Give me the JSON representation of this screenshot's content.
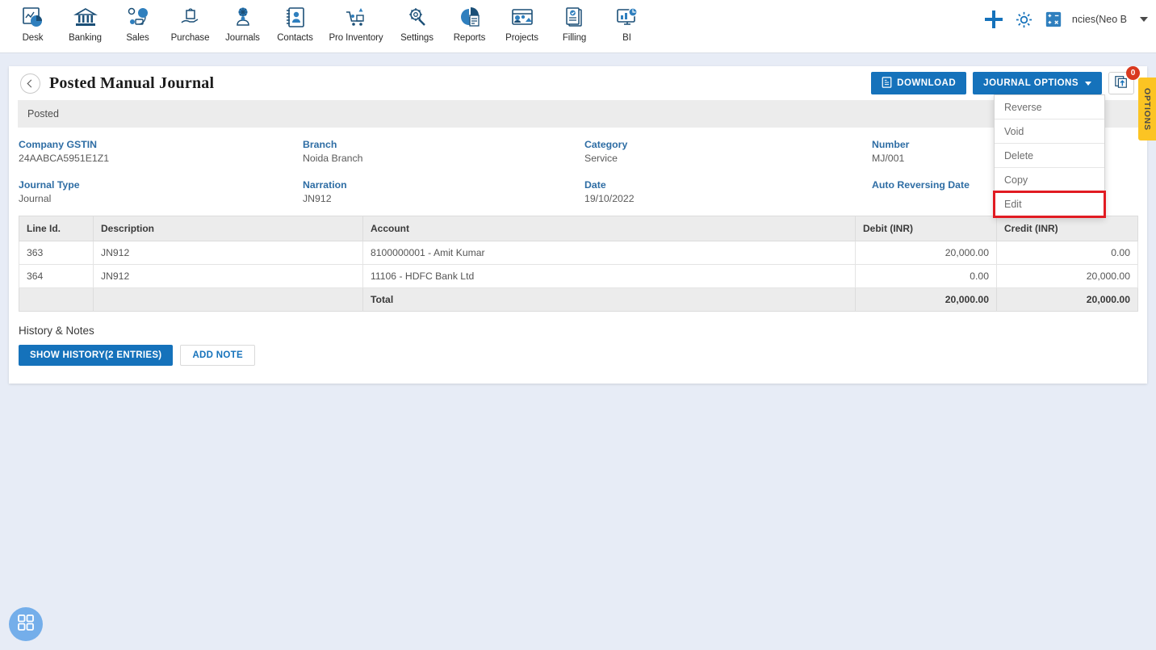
{
  "nav": {
    "items": [
      {
        "label": "Desk",
        "icon": "desk-icon"
      },
      {
        "label": "Banking",
        "icon": "bank-icon"
      },
      {
        "label": "Sales",
        "icon": "sales-icon"
      },
      {
        "label": "Purchase",
        "icon": "purchase-icon"
      },
      {
        "label": "Journals",
        "icon": "journals-icon"
      },
      {
        "label": "Contacts",
        "icon": "contacts-icon"
      },
      {
        "label": "Pro Inventory",
        "icon": "inventory-icon"
      },
      {
        "label": "Settings",
        "icon": "settings-icon"
      },
      {
        "label": "Reports",
        "icon": "reports-icon"
      },
      {
        "label": "Projects",
        "icon": "projects-icon"
      },
      {
        "label": "Filling",
        "icon": "filling-icon"
      },
      {
        "label": "BI",
        "icon": "bi-icon"
      }
    ],
    "right": {
      "add_icon": "plus-icon",
      "settings_icon": "gear-icon",
      "calculator_icon": "calculator-icon",
      "company": "ncies(Neo B",
      "chevron_icon": "chevron-down-icon"
    }
  },
  "header": {
    "back_icon": "back-chevron-icon",
    "title": "Posted Manual Journal",
    "download_label": "DOWNLOAD",
    "download_icon": "pdf-document-icon",
    "journal_options_label": "JOURNAL OPTIONS",
    "attach_icon": "upload-attachment-icon",
    "attach_badge": "0",
    "options_tab_label": "OPTIONS"
  },
  "dropdown": {
    "items": [
      {
        "label": "Reverse",
        "highlighted": false
      },
      {
        "label": "Void",
        "highlighted": false
      },
      {
        "label": "Delete",
        "highlighted": false
      },
      {
        "label": "Copy",
        "highlighted": false
      },
      {
        "label": "Edit",
        "highlighted": true
      }
    ]
  },
  "status": {
    "label": "Posted"
  },
  "details": [
    {
      "label": "Company GSTIN",
      "value": "24AABCA5951E1Z1"
    },
    {
      "label": "Branch",
      "value": "Noida Branch"
    },
    {
      "label": "Category",
      "value": "Service"
    },
    {
      "label": "Number",
      "value": "MJ/001"
    },
    {
      "label": "Journal Type",
      "value": "Journal"
    },
    {
      "label": "Narration",
      "value": "JN912"
    },
    {
      "label": "Date",
      "value": "19/10/2022"
    },
    {
      "label": "Auto Reversing Date",
      "value": ""
    }
  ],
  "table": {
    "columns": [
      "Line Id.",
      "Description",
      "Account",
      "Debit (INR)",
      "Credit (INR)"
    ],
    "rows": [
      {
        "line_id": "363",
        "description": "JN912",
        "account": "8100000001 - Amit Kumar",
        "debit": "20,000.00",
        "credit": "0.00"
      },
      {
        "line_id": "364",
        "description": "JN912",
        "account": "11106 - HDFC Bank Ltd",
        "debit": "0.00",
        "credit": "20,000.00"
      }
    ],
    "total": {
      "line_id": "",
      "description": "",
      "account": "Total",
      "debit": "20,000.00",
      "credit": "20,000.00"
    }
  },
  "history": {
    "title": "History & Notes",
    "show_history_label": "SHOW HISTORY(2 ENTRIES)",
    "add_note_label": "ADD NOTE"
  },
  "fab": {
    "icon": "grid-apps-icon"
  },
  "colors": {
    "accent_blue": "#1572bb",
    "label_blue": "#2e6da4",
    "highlight_red": "#e11b22",
    "options_yellow": "#fcc423",
    "badge_red": "#d9391f",
    "page_bg": "#e7ecf6"
  }
}
